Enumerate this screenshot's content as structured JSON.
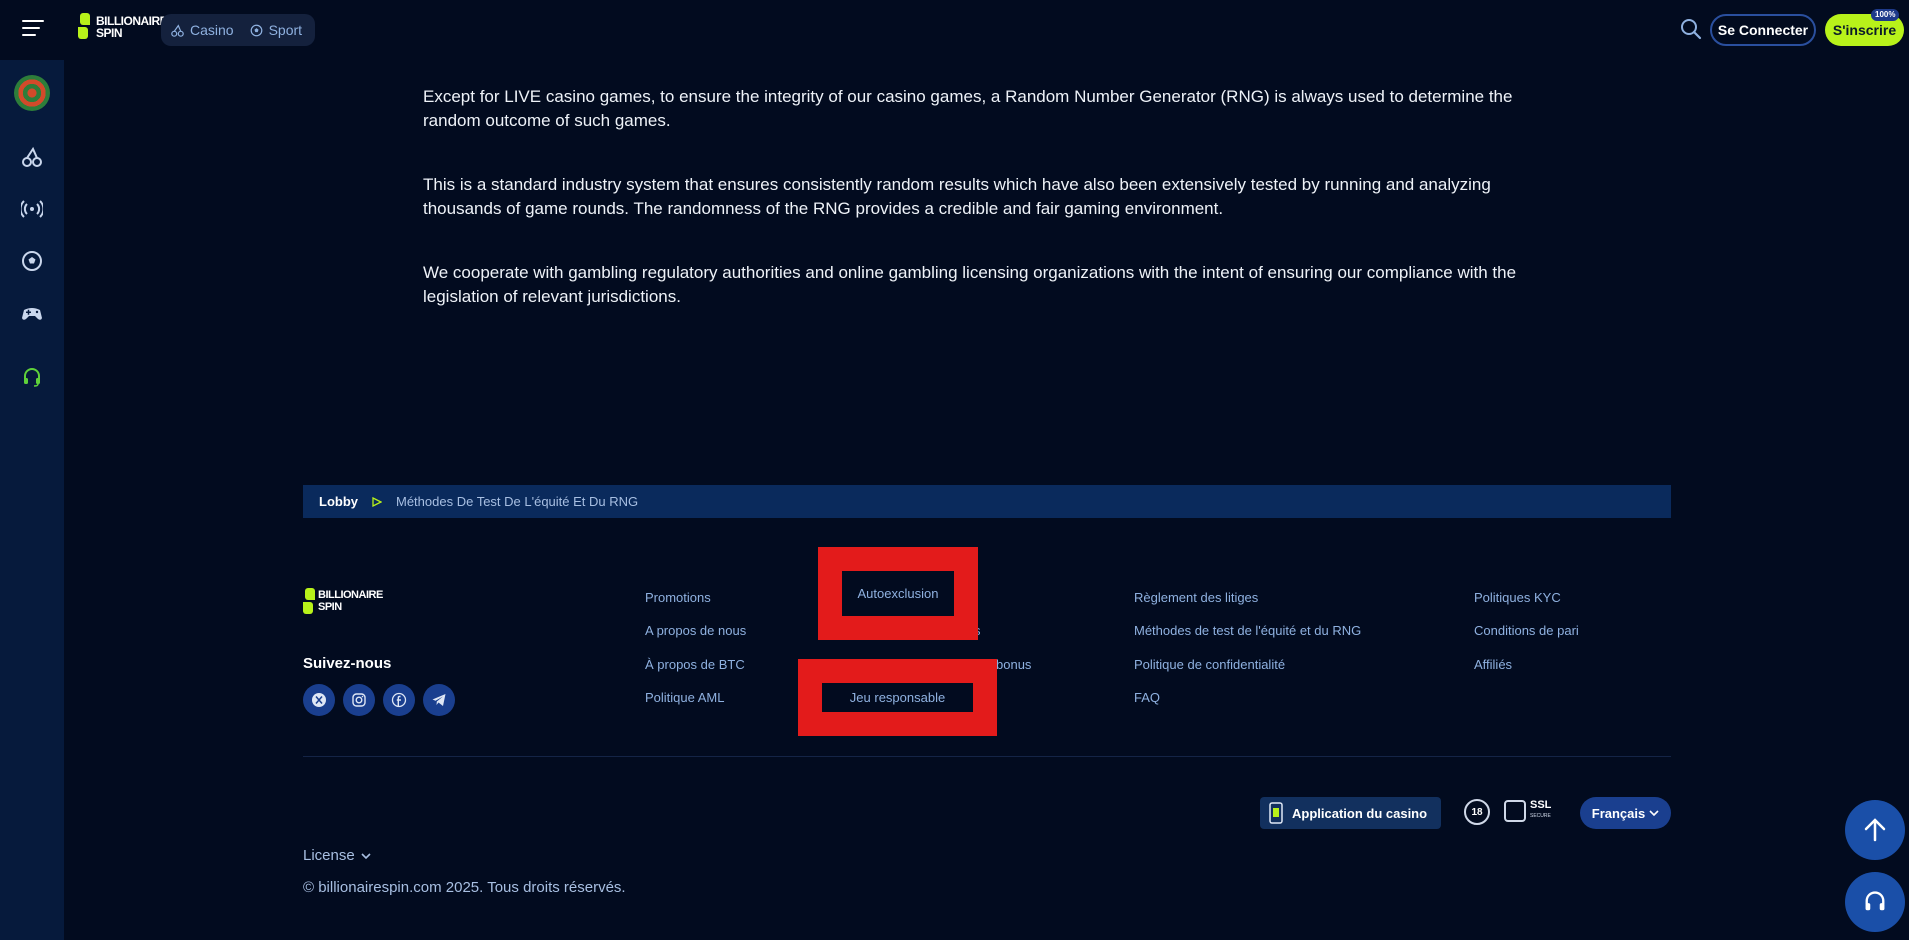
{
  "header": {
    "logo_line1": "BILLIONAIRE",
    "logo_line2": "SPIN",
    "nav": [
      {
        "label": "Casino"
      },
      {
        "label": "Sport"
      }
    ],
    "login_label": "Se Connecter",
    "register_label": "S'inscrire",
    "register_badge": "100%"
  },
  "sidebar": {
    "icons": [
      "target-icon",
      "cherry-icon",
      "live-signal-icon",
      "soccer-ball-icon",
      "gamepad-icon",
      "headset-icon"
    ]
  },
  "content": {
    "paragraphs": [
      "Except for LIVE casino games, to ensure the integrity of our casino games, a Random Number Generator (RNG) is always used to determine the random outcome of such games.",
      "This is a standard industry system that ensures consistently random results which have also been extensively tested by running and analyzing thousands of game rounds. The randomness of the RNG provides a credible and fair gaming environment.",
      "We cooperate with gambling regulatory authorities and online gambling licensing organizations with the intent of ensuring our compliance with the legislation of relevant jurisdictions."
    ]
  },
  "breadcrumb": {
    "lobby": "Lobby",
    "current": "Méthodes De Test De L'équité Et Du RNG"
  },
  "footer": {
    "logo_line1": "BILLIONAIRE",
    "logo_line2": "SPIN",
    "follow_label": "Suivez-nous",
    "col1": [
      "Promotions",
      "A propos de nous",
      "À propos de BTC",
      "Politique AML"
    ],
    "col2": [
      "Autoexclusion",
      "s",
      "bonus",
      "Jeu responsable"
    ],
    "col3": [
      "Règlement des litiges",
      "Méthodes de test de l'équité et du RNG",
      "Politique de confidentialité",
      "FAQ"
    ],
    "col4": [
      "Politiques KYC",
      "Conditions de pari",
      "Affiliés"
    ],
    "app_label": "Application du casino",
    "age_label": "18",
    "ssl_label": "SSL",
    "ssl_sub": "SECURE",
    "language": "Français",
    "license_label": "License",
    "copyright": "© billionairespin.com 2025. Tous droits réservés."
  },
  "colors": {
    "background": "#020b1f",
    "sidebar": "#061a3c",
    "accent_green": "#b8f21a",
    "link": "#8fb1e0",
    "highlight_red": "#e31b1b"
  }
}
